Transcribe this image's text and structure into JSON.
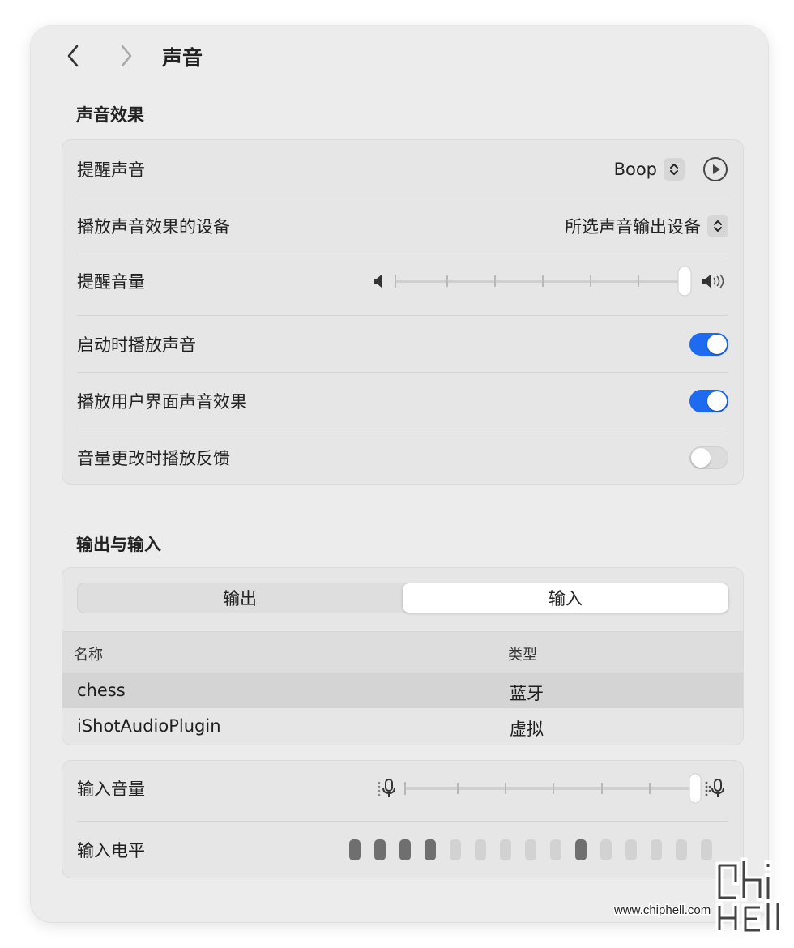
{
  "header": {
    "title": "声音"
  },
  "sound_effects": {
    "section_title": "声音效果",
    "alert_sound_label": "提醒声音",
    "alert_sound_value": "Boop",
    "device_label": "播放声音效果的设备",
    "device_value": "所选声音输出设备",
    "alert_volume_label": "提醒音量",
    "alert_volume_level": 0.99,
    "startup_label": "启动时播放声音",
    "startup_on": true,
    "ui_effects_label": "播放用户界面声音效果",
    "ui_effects_on": true,
    "feedback_label": "音量更改时播放反馈",
    "feedback_on": false
  },
  "io": {
    "section_title": "输出与输入",
    "tab_output": "输出",
    "tab_input": "输入",
    "active_tab": "输入",
    "col_name": "名称",
    "col_type": "类型",
    "rows": [
      {
        "name": "chess",
        "type": "蓝牙"
      },
      {
        "name": "iShotAudioPlugin",
        "type": "虚拟"
      }
    ],
    "input_volume_label": "输入音量",
    "input_volume_level": 0.99,
    "input_level_label": "输入电平",
    "input_level_bars": [
      1,
      1,
      1,
      1,
      0,
      0,
      0,
      0,
      0,
      1,
      0,
      0,
      0,
      0,
      0
    ]
  },
  "colors": {
    "accent": "#1e6bf0",
    "row_selected": "#d4d4d4"
  },
  "watermark": {
    "text": "www.chiphell.com"
  }
}
